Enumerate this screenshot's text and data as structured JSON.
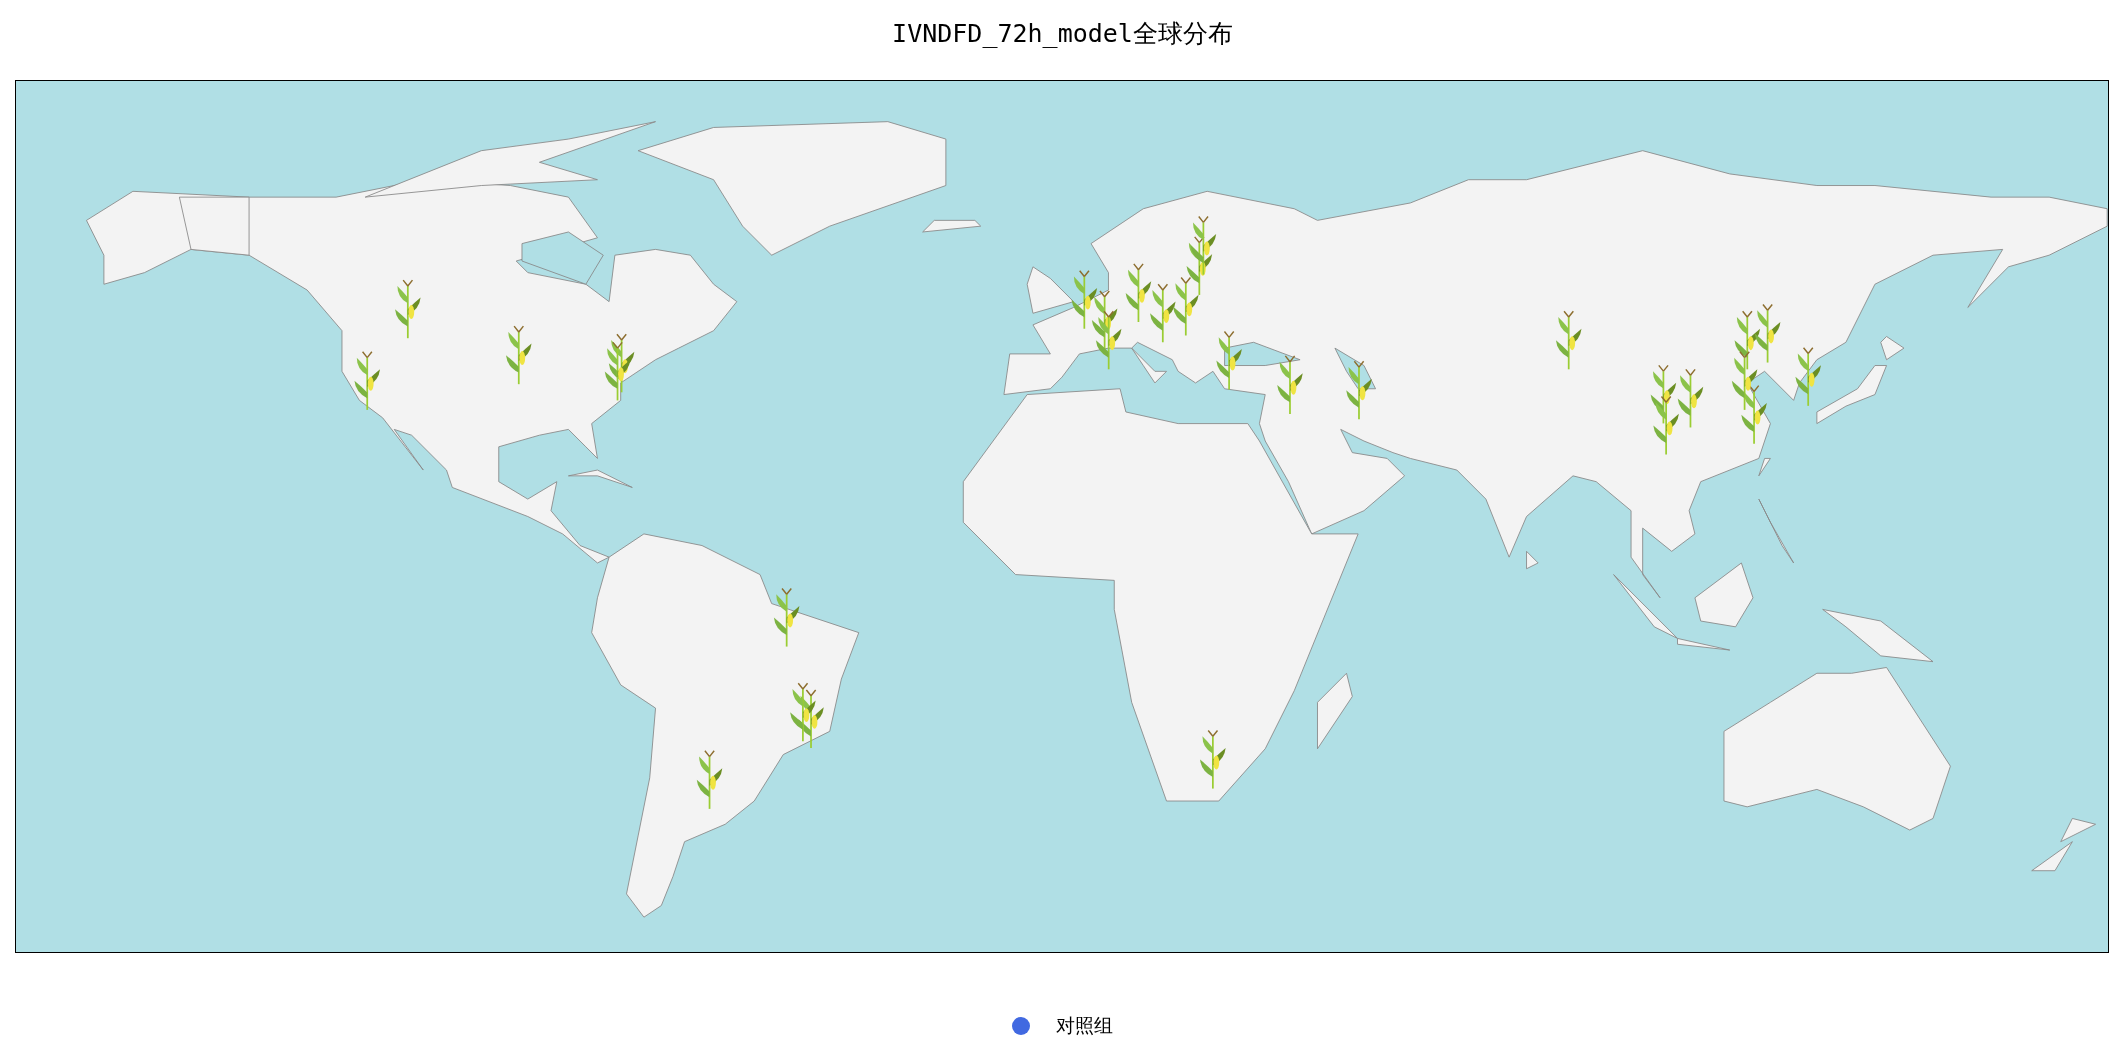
{
  "title": "IVNDFD_72h_model全球分布",
  "legend": [
    {
      "label": "对照组",
      "color": "#4169e1"
    }
  ]
}
